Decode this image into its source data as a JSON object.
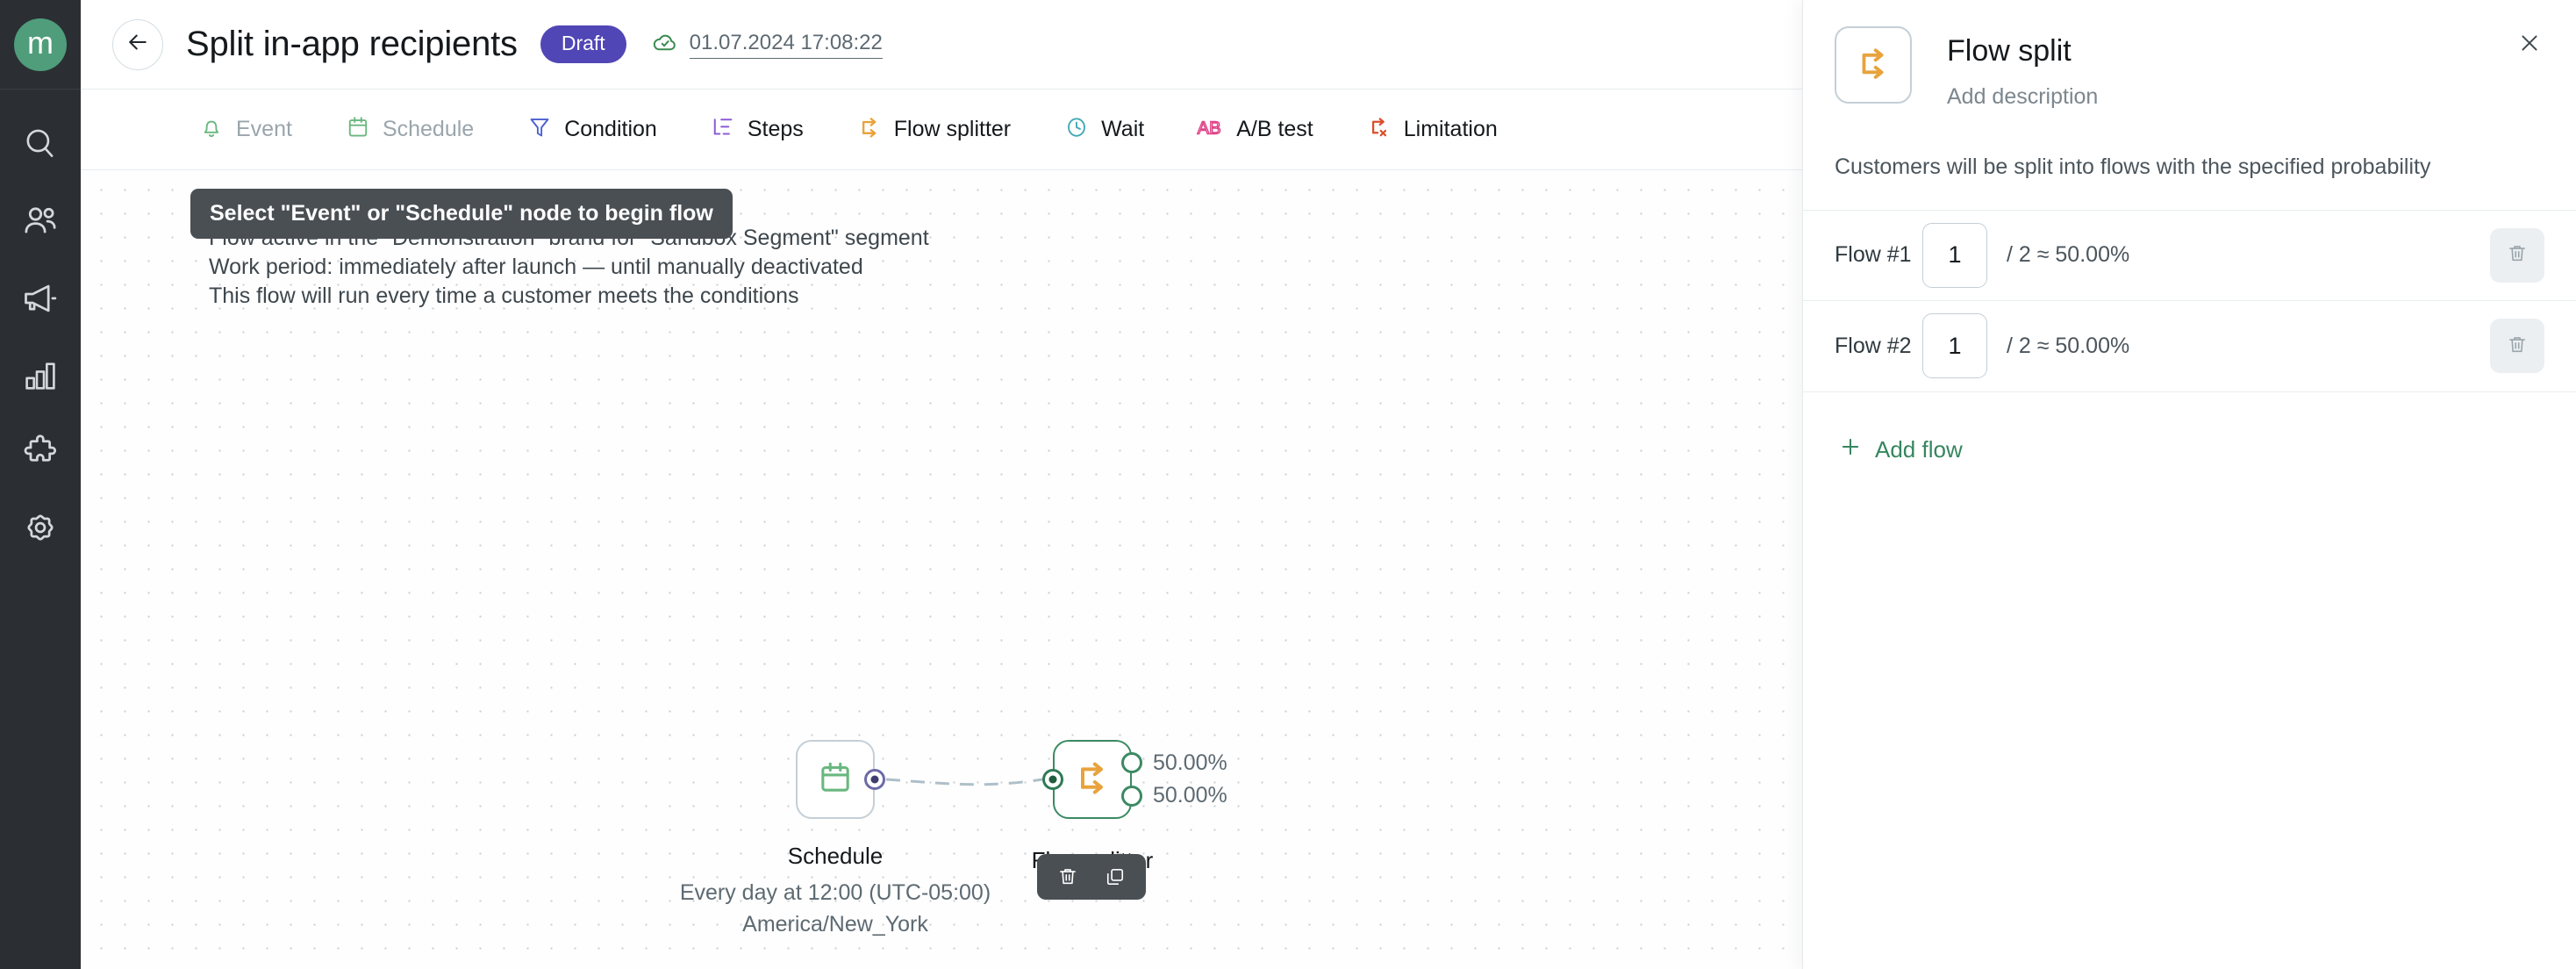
{
  "sidebar": {
    "logo_letter": "m",
    "items": [
      {
        "name": "search",
        "icon": "search-icon"
      },
      {
        "name": "customers",
        "icon": "users-icon"
      },
      {
        "name": "campaigns",
        "icon": "megaphone-icon"
      },
      {
        "name": "analytics",
        "icon": "bar-chart-icon"
      },
      {
        "name": "integrations",
        "icon": "puzzle-icon"
      },
      {
        "name": "settings",
        "icon": "gear-icon"
      }
    ]
  },
  "topbar": {
    "back_icon": "arrow-left-icon",
    "title": "Split in-app recipients",
    "status": "Draft",
    "status_color": "#5146b5",
    "saved_icon": "cloud-check-icon",
    "saved_time": "01.07.2024 17:08:22"
  },
  "toolbar": {
    "items": [
      {
        "label": "Event",
        "icon": "bell-icon",
        "color": "#6ab77f",
        "disabled": true
      },
      {
        "label": "Schedule",
        "icon": "calendar-icon",
        "color": "#6ab77f",
        "disabled": true
      },
      {
        "label": "Condition",
        "icon": "funnel-icon",
        "color": "#4a5fd1",
        "disabled": false
      },
      {
        "label": "Steps",
        "icon": "steps-icon",
        "color": "#8b5cd6",
        "disabled": false
      },
      {
        "label": "Flow splitter",
        "icon": "flow-splitter-icon",
        "color": "#e8a33d",
        "disabled": false
      },
      {
        "label": "Wait",
        "icon": "clock-icon",
        "color": "#3fa9b5",
        "disabled": false
      },
      {
        "label": "A/B test",
        "icon": "ab-test-icon",
        "color": "#e0458a",
        "disabled": false
      },
      {
        "label": "Limitation",
        "icon": "limitation-icon",
        "color": "#d94f2b",
        "disabled": false
      }
    ]
  },
  "canvas": {
    "tooltip": "Select \"Event\" or \"Schedule\" node to begin flow",
    "notes": [
      "Flow active in the \"Demonstration\" brand for \"Sandbox Segment\" segment",
      "Work period: immediately after launch — until manually deactivated",
      "This flow will run every time a customer meets the conditions"
    ],
    "node_toolbar": {
      "delete_icon": "trash-icon",
      "duplicate_icon": "copy-icon"
    },
    "nodes": [
      {
        "id": "schedule",
        "label": "Schedule",
        "icon": "calendar-icon",
        "sub_lines": [
          "Every day at 12:00 (UTC-05:00)",
          "America/New_York"
        ]
      },
      {
        "id": "flow-splitter",
        "label": "Flow splitter",
        "icon": "flow-splitter-icon",
        "outputs": [
          "50.00%",
          "50.00%"
        ]
      }
    ]
  },
  "panel": {
    "icon": "flow-splitter-icon",
    "title": "Flow split",
    "description_placeholder": "Add description",
    "close_icon": "close-icon",
    "intro": "Customers will be split into flows with the specified probability",
    "rows": [
      {
        "name": "Flow #1",
        "value": "1",
        "expression": "/ 2 ≈ 50.00%",
        "delete_icon": "trash-icon"
      },
      {
        "name": "Flow #2",
        "value": "1",
        "expression": "/ 2 ≈ 50.00%",
        "delete_icon": "trash-icon"
      }
    ],
    "add_flow_label": "Add flow",
    "add_icon": "plus-icon",
    "accent_color": "#35865f"
  }
}
